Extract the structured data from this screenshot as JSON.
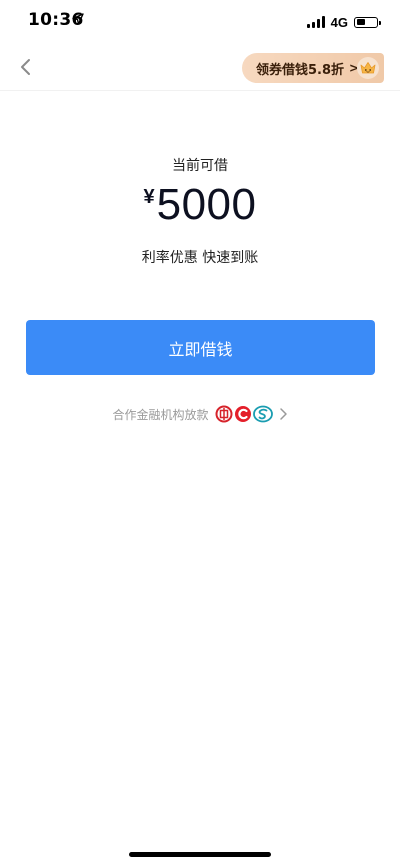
{
  "status_bar": {
    "time": "10:36",
    "network": "4G",
    "battery_level": 0.45
  },
  "nav": {
    "coupon_banner_label": "领券借钱5.8折",
    "coupon_arrow": ">"
  },
  "loan": {
    "label": "当前可借",
    "currency": "¥",
    "amount": "5000",
    "subtitle": "利率优惠 快速到账"
  },
  "actions": {
    "borrow_button_label": "立即借钱"
  },
  "partner": {
    "label": "合作金融机构放款",
    "logos": [
      "icbc-logo",
      "cmb-logo",
      "citic-logo"
    ]
  },
  "colors": {
    "primary_button": "#3b8bf7",
    "coupon_gold": "#f0c9a8",
    "muted_text": "#9a9a9a"
  }
}
